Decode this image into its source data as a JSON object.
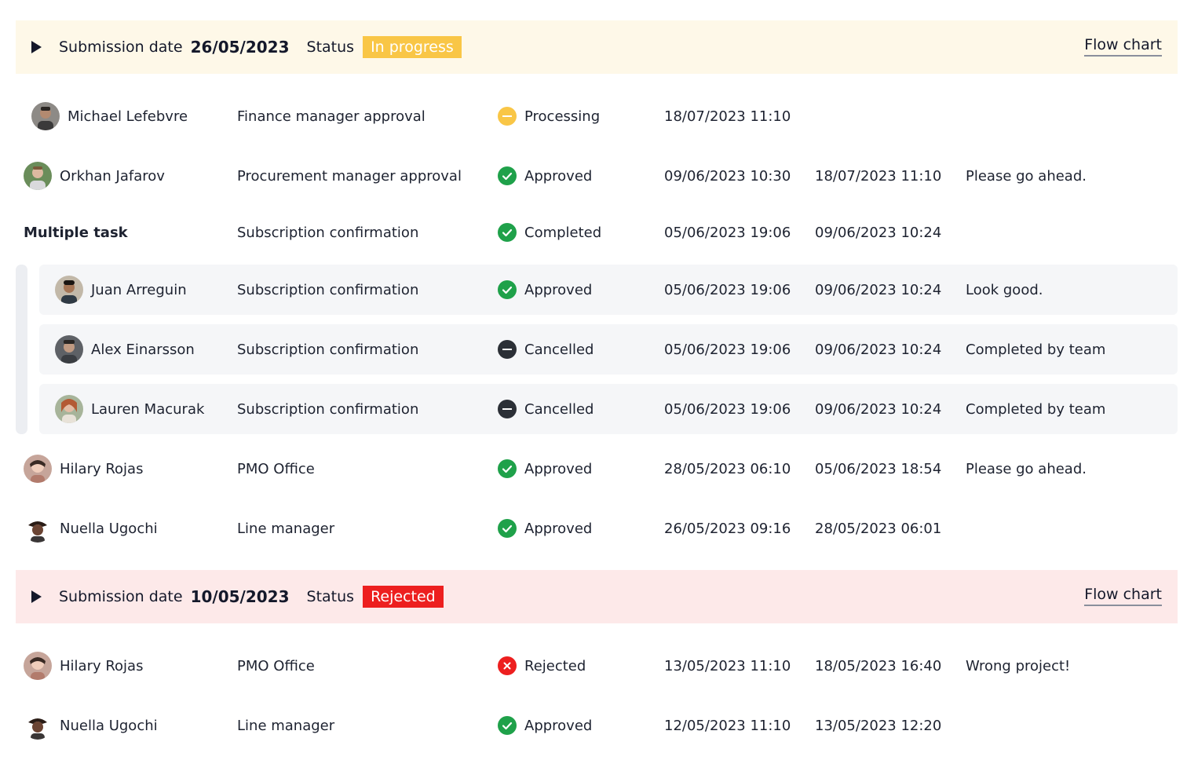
{
  "submissions": [
    {
      "date_label": "Submission date",
      "date": "26/05/2023",
      "status_label": "Status",
      "status": "In progress",
      "flow_chart": "Flow chart",
      "rows": [
        {
          "name": "Michael Lefebvre",
          "task": "Finance manager approval",
          "status": "Processing",
          "start": "18/07/2023 11:10",
          "end": "",
          "comment": ""
        },
        {
          "name": "Orkhan Jafarov",
          "task": "Procurement manager approval",
          "status": "Approved",
          "start": "09/06/2023 10:30",
          "end": "18/07/2023 11:10",
          "comment": "Please go ahead."
        },
        {
          "name": "Multiple task",
          "task": "Subscription confirmation",
          "status": "Completed",
          "start": "05/06/2023 19:06",
          "end": "09/06/2023 10:24",
          "comment": ""
        },
        {
          "name": "Juan Arreguin",
          "task": "Subscription confirmation",
          "status": "Approved",
          "start": "05/06/2023 19:06",
          "end": "09/06/2023 10:24",
          "comment": "Look good."
        },
        {
          "name": "Alex Einarsson",
          "task": "Subscription confirmation",
          "status": "Cancelled",
          "start": "05/06/2023 19:06",
          "end": "09/06/2023 10:24",
          "comment": "Completed by team"
        },
        {
          "name": "Lauren Macurak",
          "task": "Subscription confirmation",
          "status": "Cancelled",
          "start": "05/06/2023 19:06",
          "end": "09/06/2023 10:24",
          "comment": "Completed by team"
        },
        {
          "name": "Hilary Rojas",
          "task": "PMO Office",
          "status": "Approved",
          "start": "28/05/2023 06:10",
          "end": "05/06/2023 18:54",
          "comment": "Please go ahead."
        },
        {
          "name": "Nuella Ugochi",
          "task": "Line manager",
          "status": "Approved",
          "start": "26/05/2023 09:16",
          "end": "28/05/2023 06:01",
          "comment": ""
        }
      ]
    },
    {
      "date_label": "Submission date",
      "date": "10/05/2023",
      "status_label": "Status",
      "status": "Rejected",
      "flow_chart": "Flow chart",
      "rows": [
        {
          "name": "Hilary Rojas",
          "task": "PMO Office",
          "status": "Rejected",
          "start": "13/05/2023 11:10",
          "end": "18/05/2023 16:40",
          "comment": "Wrong project!"
        },
        {
          "name": "Nuella Ugochi",
          "task": "Line manager",
          "status": "Approved",
          "start": "12/05/2023 11:10",
          "end": "13/05/2023 12:20",
          "comment": ""
        }
      ]
    }
  ],
  "colors": {
    "in_progress": "#f9c646",
    "rejected": "#ed1f1f",
    "approved": "#1fa14a",
    "cancelled": "#2b2f36",
    "processing": "#f9c646"
  }
}
